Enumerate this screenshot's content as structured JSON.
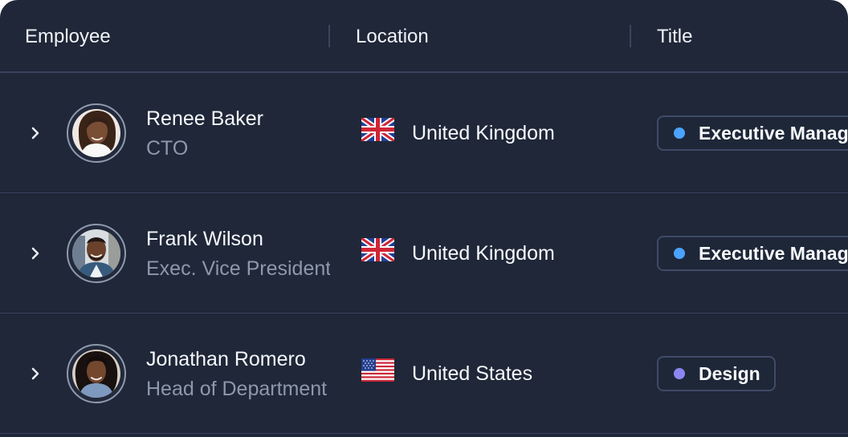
{
  "table": {
    "columns": {
      "employee": "Employee",
      "location": "Location",
      "title": "Title"
    },
    "rows": [
      {
        "name": "Renee Baker",
        "role": "CTO",
        "avatar_icon": "person-avatar-icon",
        "flag_icon": "uk-flag-icon",
        "location": "United Kingdom",
        "title": "Executive Management",
        "title_dot_color": "#4aa3ff"
      },
      {
        "name": "Frank Wilson",
        "role": "Exec. Vice President",
        "avatar_icon": "person-avatar-icon",
        "flag_icon": "uk-flag-icon",
        "location": "United Kingdom",
        "title": "Executive Management",
        "title_dot_color": "#4aa3ff"
      },
      {
        "name": "Jonathan Romero",
        "role": "Head of Department",
        "avatar_icon": "person-avatar-icon",
        "flag_icon": "us-flag-icon",
        "location": "United States",
        "title": "Design",
        "title_dot_color": "#8c86f2"
      }
    ]
  },
  "colors": {
    "background": "#1f2738",
    "divider": "#38425a",
    "text_primary": "#f6f8fb",
    "text_secondary": "#8e98ab",
    "badge_border": "#3f4a67",
    "accent_blue": "#4aa3ff",
    "accent_purple": "#8c86f2"
  }
}
